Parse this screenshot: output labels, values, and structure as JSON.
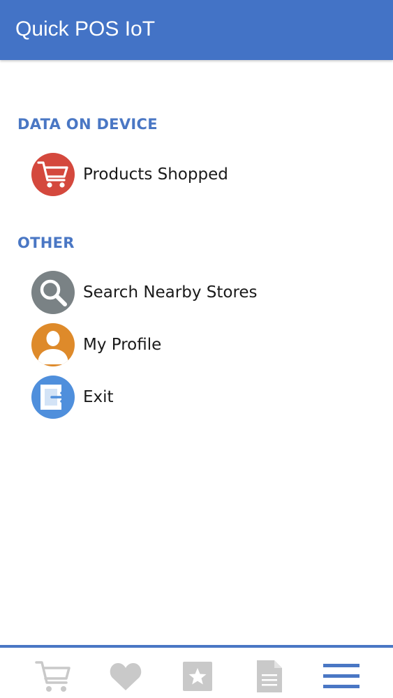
{
  "app_bar": {
    "title": "Quick POS IoT"
  },
  "sections": [
    {
      "header": "DATA ON DEVICE",
      "items": [
        {
          "label": "Products Shopped",
          "icon": "shopping-cart-icon",
          "color": "#d4483d"
        }
      ]
    },
    {
      "header": "OTHER",
      "items": [
        {
          "label": "Search Nearby Stores",
          "icon": "search-icon",
          "color": "#7a8285"
        },
        {
          "label": "My Profile",
          "icon": "user-icon",
          "color": "#de8a2a"
        },
        {
          "label": "Exit",
          "icon": "exit-icon",
          "color": "#4f8fdc"
        }
      ]
    }
  ],
  "bottom_nav": {
    "items": [
      {
        "icon": "cart-icon",
        "active": false
      },
      {
        "icon": "heart-icon",
        "active": false
      },
      {
        "icon": "star-icon",
        "active": false
      },
      {
        "icon": "document-icon",
        "active": false
      },
      {
        "icon": "hamburger-menu-icon",
        "active": true
      }
    ],
    "inactive_color": "#c9c9c9",
    "active_color": "#4a77c4"
  },
  "colors": {
    "primary": "#4373c6",
    "section_header": "#4a77c4",
    "text": "#1a1a1a",
    "background": "#ffffff"
  }
}
